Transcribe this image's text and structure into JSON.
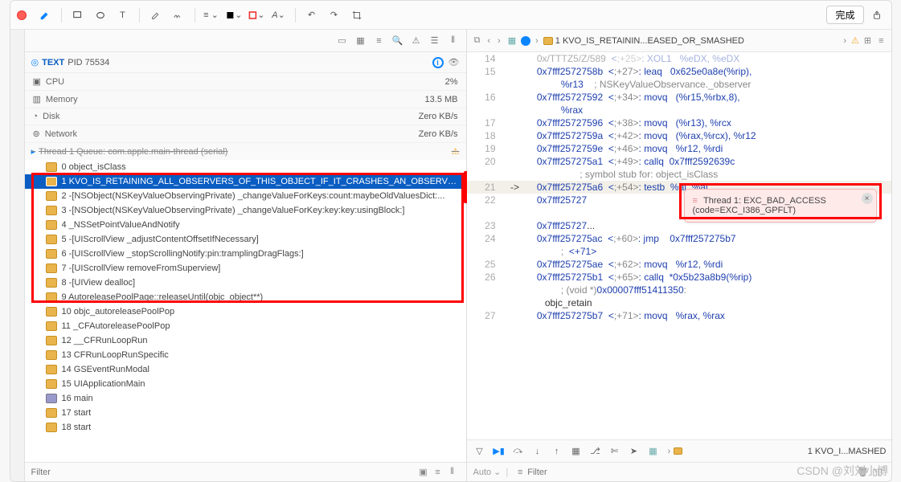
{
  "toolbar": {
    "finish_label": "完成"
  },
  "process": {
    "name": "TEXT",
    "pid_label": "PID 75534"
  },
  "stats": [
    {
      "name": "CPU",
      "value": "2%"
    },
    {
      "name": "Memory",
      "value": "13.5 MB"
    },
    {
      "name": "Disk",
      "value": "Zero KB/s"
    },
    {
      "name": "Network",
      "value": "Zero KB/s"
    }
  ],
  "thread_header": "Thread 1 Queue: com.apple.main-thread (serial)",
  "stack": [
    {
      "idx": "0",
      "label": "object_isClass",
      "user": false
    },
    {
      "idx": "1",
      "label": "KVO_IS_RETAINING_ALL_OBSERVERS_OF_THIS_OBJECT_IF_IT_CRASHES_AN_OBSERVER_WAS_...",
      "user": false,
      "sel": true
    },
    {
      "idx": "2",
      "label": "-[NSObject(NSKeyValueObservingPrivate) _changeValueForKeys:count:maybeOldValuesDict:...",
      "user": false
    },
    {
      "idx": "3",
      "label": "-[NSObject(NSKeyValueObservingPrivate) _changeValueForKey:key:key:usingBlock:]",
      "user": false
    },
    {
      "idx": "4",
      "label": "_NSSetPointValueAndNotify",
      "user": false
    },
    {
      "idx": "5",
      "label": "-[UIScrollView _adjustContentOffsetIfNecessary]",
      "user": false
    },
    {
      "idx": "6",
      "label": "-[UIScrollView _stopScrollingNotify:pin:tramplingDragFlags:]",
      "user": false
    },
    {
      "idx": "7",
      "label": "-[UIScrollView removeFromSuperview]",
      "user": false
    },
    {
      "idx": "8",
      "label": "-[UIView dealloc]",
      "user": false
    },
    {
      "idx": "9",
      "label": "AutoreleasePoolPage::releaseUntil(objc_object**)",
      "user": false
    },
    {
      "idx": "10",
      "label": "objc_autoreleasePoolPop",
      "user": false
    },
    {
      "idx": "11",
      "label": "_CFAutoreleasePoolPop",
      "user": false
    },
    {
      "idx": "12",
      "label": "__CFRunLoopRun",
      "user": false
    },
    {
      "idx": "13",
      "label": "CFRunLoopRunSpecific",
      "user": false
    },
    {
      "idx": "14",
      "label": "GSEventRunModal",
      "user": false
    },
    {
      "idx": "15",
      "label": "UIApplicationMain",
      "user": false
    },
    {
      "idx": "16",
      "label": "main",
      "user": true
    },
    {
      "idx": "17",
      "label": "start",
      "user": false
    },
    {
      "idx": "18",
      "label": "start",
      "user": false
    }
  ],
  "crumb_title": "1 KVO_IS_RETAININ...EASED_OR_SMASHED",
  "code_lines": [
    {
      "n": "14",
      "text": "0x/TTTZ5/Z/589  <+25>: XOL1   %eDX, %eDX",
      "faded": true
    },
    {
      "n": "15",
      "text": "0x7fff2572758b  <+27>: leaq   0x625e0a8e(%rip),\n         %r13    ; NSKeyValueObservance._observer"
    },
    {
      "n": "16",
      "text": "0x7fff25727592  <+34>: movq   (%r15,%rbx,8),\n         %rax"
    },
    {
      "n": "17",
      "text": "0x7fff25727596  <+38>: movq   (%r13), %rcx"
    },
    {
      "n": "18",
      "text": "0x7fff2572759a  <+42>: movq   (%rax,%rcx), %r12"
    },
    {
      "n": "19",
      "text": "0x7fff2572759e  <+46>: movq   %r12, %rdi"
    },
    {
      "n": "20",
      "text": "0x7fff257275a1  <+49>: callq  0x7fff2592639c\n                ; symbol stub for: object_isClass"
    },
    {
      "n": "21",
      "text": "0x7fff257275a6  <+54>: testb  %al, %al",
      "cur": true
    },
    {
      "n": "22",
      "text": "0x7fff25727"
    },
    {
      "n": "",
      "text": ""
    },
    {
      "n": "23",
      "text": "0x7fff25727..."
    },
    {
      "n": "24",
      "text": "0x7fff257275ac  <+60>: jmp    0x7fff257275b7\n         ;  <+71>"
    },
    {
      "n": "25",
      "text": "0x7fff257275ae  <+62>: movq   %r12, %rdi"
    },
    {
      "n": "26",
      "text": "0x7fff257275b1  <+65>: callq  *0x5b23a8b9(%rip)\n         ; (void *)0x00007fff51411350:\n   objc_retain"
    },
    {
      "n": "27",
      "text": "0x7fff257275b7  <+71>: movq   %rax, %rax"
    }
  ],
  "error": {
    "line1": "Thread 1: EXC_BAD_ACCESS",
    "line2": "(code=EXC_I386_GPFLT)"
  },
  "debug_title": "1 KVO_I...MASHED",
  "auto_label": "Auto ⌄",
  "filter_placeholder": "Filter",
  "watermark": "CSDN @刘刘小博"
}
